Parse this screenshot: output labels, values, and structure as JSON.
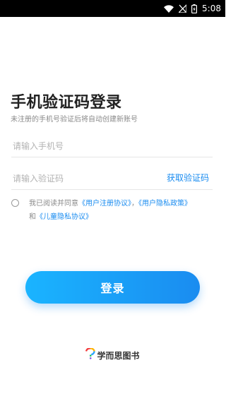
{
  "status_bar": {
    "time": "5:08",
    "icons": [
      "wifi-icon",
      "signal-off-icon",
      "battery-charging-icon"
    ]
  },
  "title": "手机验证码登录",
  "subtitle": "未注册的手机号验证后将自动创建新账号",
  "phone_field": {
    "value": "",
    "placeholder": "请输入手机号"
  },
  "code_field": {
    "value": "",
    "placeholder": "请输入验证码"
  },
  "get_code_label": "获取验证码",
  "agreement": {
    "checked": false,
    "prefix": "我已阅读并同意",
    "user_agreement": "《用户注册协议》",
    "sep1": "，",
    "privacy_policy": "《用户隐私政策》",
    "conj": "和",
    "child_privacy": "《儿童隐私协议》"
  },
  "login_label": "登录",
  "brand": {
    "name": "学而思图书",
    "logo_icon": "brand-logo-icon"
  },
  "colors": {
    "accent": "#1a8cf0",
    "button_start": "#1ab4ff",
    "button_end": "#1a8cf0"
  }
}
